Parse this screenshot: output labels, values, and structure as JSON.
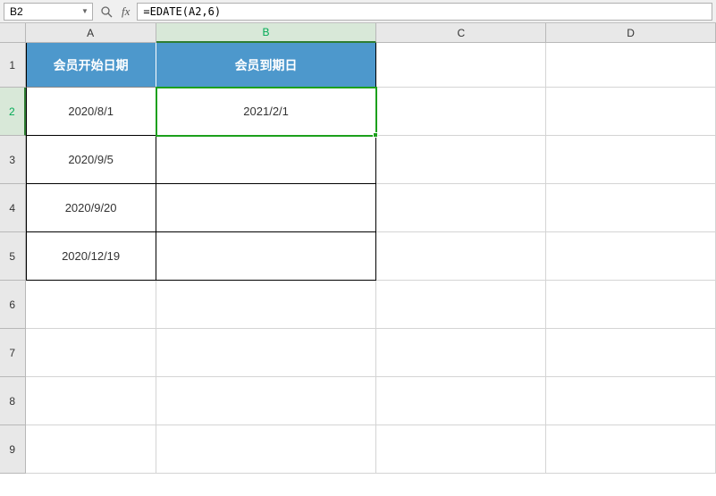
{
  "name_box": {
    "value": "B2"
  },
  "formula_bar": {
    "value": "=EDATE(A2,6)"
  },
  "columns": {
    "A": "A",
    "B": "B",
    "C": "C",
    "D": "D"
  },
  "row_labels": {
    "r1": "1",
    "r2": "2",
    "r3": "3",
    "r4": "4",
    "r5": "5",
    "r6": "6",
    "r7": "7",
    "r8": "8",
    "r9": "9"
  },
  "header": {
    "colA": "会员开始日期",
    "colB": "会员到期日"
  },
  "data": {
    "A2": "2020/8/1",
    "B2": "2021/2/1",
    "A3": "2020/9/5",
    "B3": "",
    "A4": "2020/9/20",
    "B4": "",
    "A5": "2020/12/19",
    "B5": ""
  },
  "active_cell": "B2"
}
